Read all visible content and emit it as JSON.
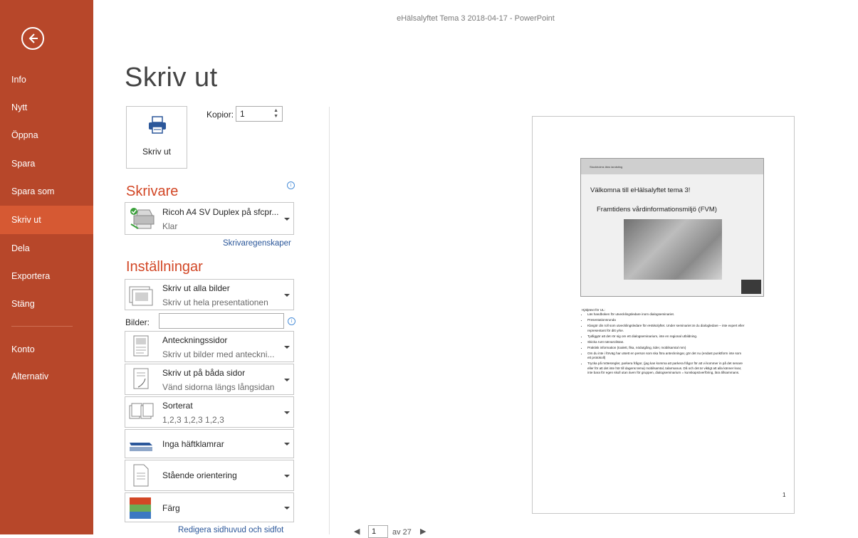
{
  "window": {
    "title": "eHälsalyftet Tema 3 2018-04-17 - PowerPoint"
  },
  "sidebar": {
    "items": [
      {
        "label": "Info"
      },
      {
        "label": "Nytt"
      },
      {
        "label": "Öppna"
      },
      {
        "label": "Spara"
      },
      {
        "label": "Spara som"
      },
      {
        "label": "Skriv ut"
      },
      {
        "label": "Dela"
      },
      {
        "label": "Exportera"
      },
      {
        "label": "Stäng"
      },
      {
        "label": "Konto"
      },
      {
        "label": "Alternativ"
      }
    ],
    "active": "Skriv ut"
  },
  "page": {
    "title": "Skriv ut"
  },
  "print": {
    "button_label": "Skriv ut",
    "copies_label": "Kopior:",
    "copies_value": "1"
  },
  "printer": {
    "heading": "Skrivare",
    "name": "Ricoh A4 SV Duplex på sfcpr...",
    "status": "Klar",
    "properties_link": "Skrivaregenskaper"
  },
  "settings": {
    "heading": "Inställningar",
    "range": {
      "title": "Skriv ut alla bilder",
      "subtitle": "Skriv ut hela presentationen"
    },
    "slides_label": "Bilder:",
    "slides_value": "",
    "layout": {
      "title": "Anteckningssidor",
      "subtitle": "Skriv ut bilder med anteckni..."
    },
    "sides": {
      "title": "Skriv ut på båda sidor",
      "subtitle": "Vänd sidorna längs långsidan"
    },
    "collate": {
      "title": "Sorterat",
      "subtitle": "1,2,3   1,2,3   1,2,3"
    },
    "staple": {
      "title": "Inga häftklamrar"
    },
    "orientation": {
      "title": "Stående orientering"
    },
    "color": {
      "title": "Färg"
    },
    "header_footer_link": "Redigera sidhuvud och sidfot"
  },
  "preview": {
    "slide_org": "Stockholms läns landsting",
    "slide_title1": "Välkomna till eHälsalyftet tema 3!",
    "slide_title2": "Framtidens vårdinformationsmiljö (FVM)",
    "notes_heading": "Hjälptext för UL:",
    "notes": [
      "Läs handboken för utvecklingsledare inom dialogseminariet.",
      "Presentationsrunda",
      "Klargör din roll som utvecklingsledare för eHälsolyftet. Under seminariet är du dialogledare – inte expert eller representant för ditt yrke.",
      "Tydliggör att det rör sig om ett dialogseminarium, inte en regional utbildning.",
      "Skicka runt närvarolistan.",
      "Praktisk information (toalett, fika, nödutgång, tider, mobilsamtal mm)",
      "Om du inte i förväg har utsett en person som ska föra anteckningar, gör det nu (endast punktform inte som ett protokoll)",
      "Trycka på mötesregler, parkera frågor, (jag kan komma att parkera frågor för att vi kommer in på det senare eller för att det inte hör till dagens tema) mobilsamtal, talarmanus. Då och det är viktigt att alla känner kvar, inte bara för egen skull utan även för gruppen, dialogseminarium = kunskapsöverföring, lära tillsammans."
    ],
    "page_number": "1"
  },
  "pager": {
    "current": "1",
    "of_text": "av 27"
  },
  "colors": {
    "accent": "#b7472a",
    "active": "#d65933",
    "heading": "#d24726",
    "link": "#2b579a"
  }
}
